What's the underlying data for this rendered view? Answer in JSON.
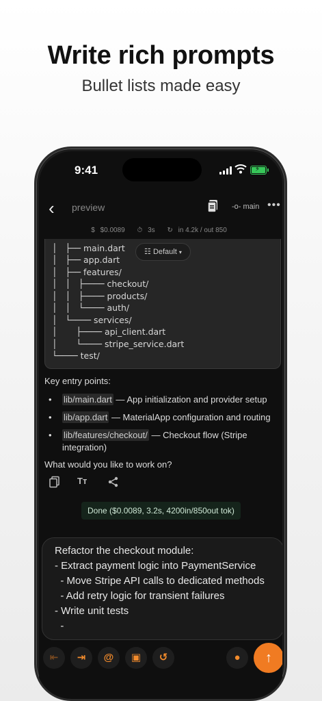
{
  "hero": {
    "title": "Write rich prompts",
    "subtitle": "Bullet lists made easy"
  },
  "status_bar": {
    "time": "9:41"
  },
  "header": {
    "title": "preview",
    "branch": "main"
  },
  "metrics": {
    "cost": "$0.0089",
    "duration": "3s",
    "tokens": "in 4.2k / out 850"
  },
  "code_block": {
    "mode_label": "Default",
    "lines": [
      "│   ├── main.dart",
      "│   ├── app.dart",
      "│   ├── features/",
      "│   │   ├──── checkout/",
      "│   │   ├──── products/",
      "│   │   └──── auth/",
      "│   └──── services/",
      "│       ├──── api_client.dart",
      "│       └──── stripe_service.dart",
      "└──── test/"
    ]
  },
  "response": {
    "entry_heading": "Key entry points:",
    "bullets": [
      {
        "code": "lib/main.dart",
        "text": " — App initialization and provider setup"
      },
      {
        "code": "lib/app.dart",
        "text": " — MaterialApp configuration and routing"
      },
      {
        "code": "lib/features/checkout/",
        "text": " — Checkout flow (Stripe integration)"
      }
    ],
    "question": "What would you like to work on?",
    "done_badge": "Done ($0.0089, 3.2s, 4200in/850out tok)"
  },
  "composer": {
    "lines": [
      "Refactor the checkout module:",
      "- Extract payment logic into PaymentService",
      "  - Move Stripe API calls to dedicated methods",
      "  - Add retry logic for transient failures",
      "- Write unit tests",
      "  -"
    ]
  },
  "colors": {
    "accent": "#f07b22",
    "background": "#0f0f0f",
    "done_bg": "#15241b"
  },
  "icons": {
    "toolbar": [
      "outdent-icon",
      "indent-icon",
      "at-icon",
      "image-icon",
      "history-icon",
      "mic-icon",
      "send-arrow-icon"
    ]
  }
}
